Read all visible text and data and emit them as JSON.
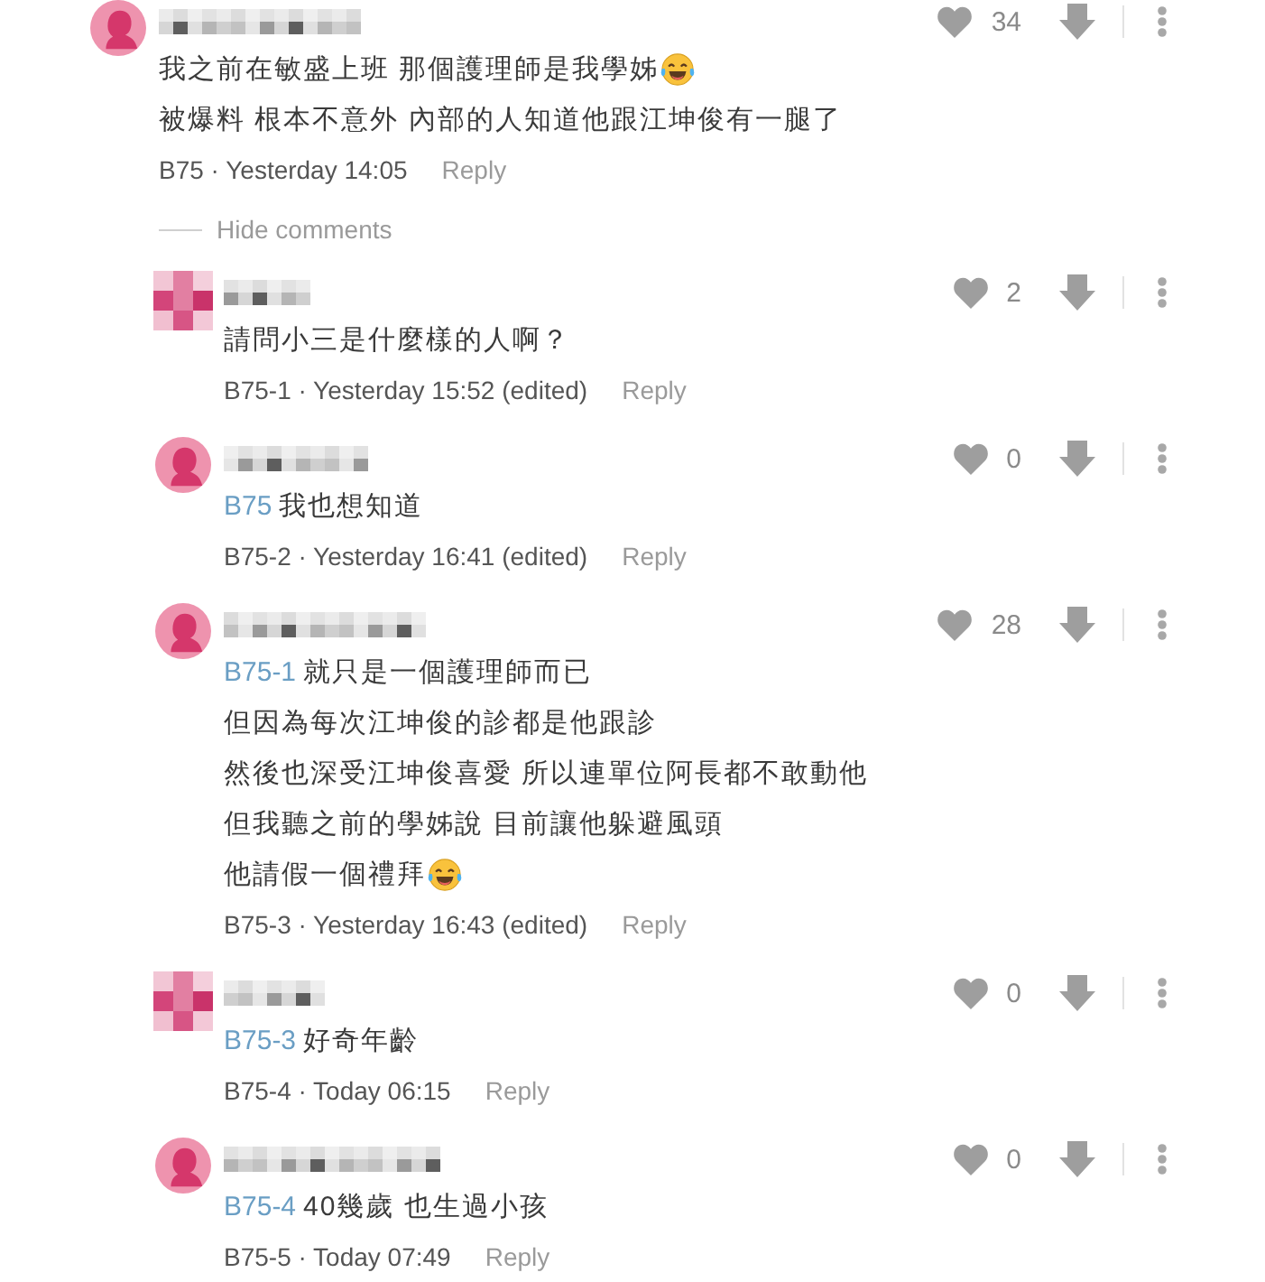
{
  "comments": [
    {
      "avatar": {
        "kind": "silhouette"
      },
      "lines": [
        {
          "text": "我之前在敏盛上班 那個護理師是我學姊",
          "emoji": true
        },
        {
          "text": "被爆料 根本不意外 內部的人知道他跟江坤俊有一腿了",
          "emoji": false
        }
      ],
      "meta": "B75 · Yesterday 14:05",
      "reply_label": "Reply",
      "likes": "34",
      "replies_toggle": "Hide comments",
      "replies_expanded": true,
      "replies": [
        {
          "avatar": {
            "kind": "pixelated"
          },
          "lines": [
            {
              "text": "請問小三是什麼樣的人啊？",
              "emoji": false
            }
          ],
          "meta": "B75-1 · Yesterday 15:52 (edited)",
          "reply_label": "Reply",
          "likes": "2"
        },
        {
          "avatar": {
            "kind": "silhouette"
          },
          "mention": "B75",
          "lines": [
            {
              "text": "我也想知道",
              "emoji": false
            }
          ],
          "meta": "B75-2 · Yesterday 16:41 (edited)",
          "reply_label": "Reply",
          "likes": "0"
        },
        {
          "avatar": {
            "kind": "silhouette"
          },
          "mention": "B75-1",
          "lines": [
            {
              "text": "就只是一個護理師而已",
              "emoji": false
            },
            {
              "text": "但因為每次江坤俊的診都是他跟診",
              "emoji": false
            },
            {
              "text": "然後也深受江坤俊喜愛 所以連單位阿長都不敢動他",
              "emoji": false
            },
            {
              "text": "但我聽之前的學姊說 目前讓他躲避風頭",
              "emoji": false
            },
            {
              "text": "他請假一個禮拜",
              "emoji": true
            }
          ],
          "meta": "B75-3 · Yesterday 16:43 (edited)",
          "reply_label": "Reply",
          "likes": "28"
        },
        {
          "avatar": {
            "kind": "pixelated"
          },
          "mention": "B75-3",
          "lines": [
            {
              "text": "好奇年齡",
              "emoji": false
            }
          ],
          "meta": "B75-4 · Today 06:15",
          "reply_label": "Reply",
          "likes": "0"
        },
        {
          "avatar": {
            "kind": "silhouette"
          },
          "mention": "B75-4",
          "lines": [
            {
              "text": "40幾歲 也生過小孩",
              "emoji": false
            }
          ],
          "meta": "B75-5 · Today 07:49",
          "reply_label": "Reply",
          "likes": "0"
        }
      ]
    }
  ]
}
